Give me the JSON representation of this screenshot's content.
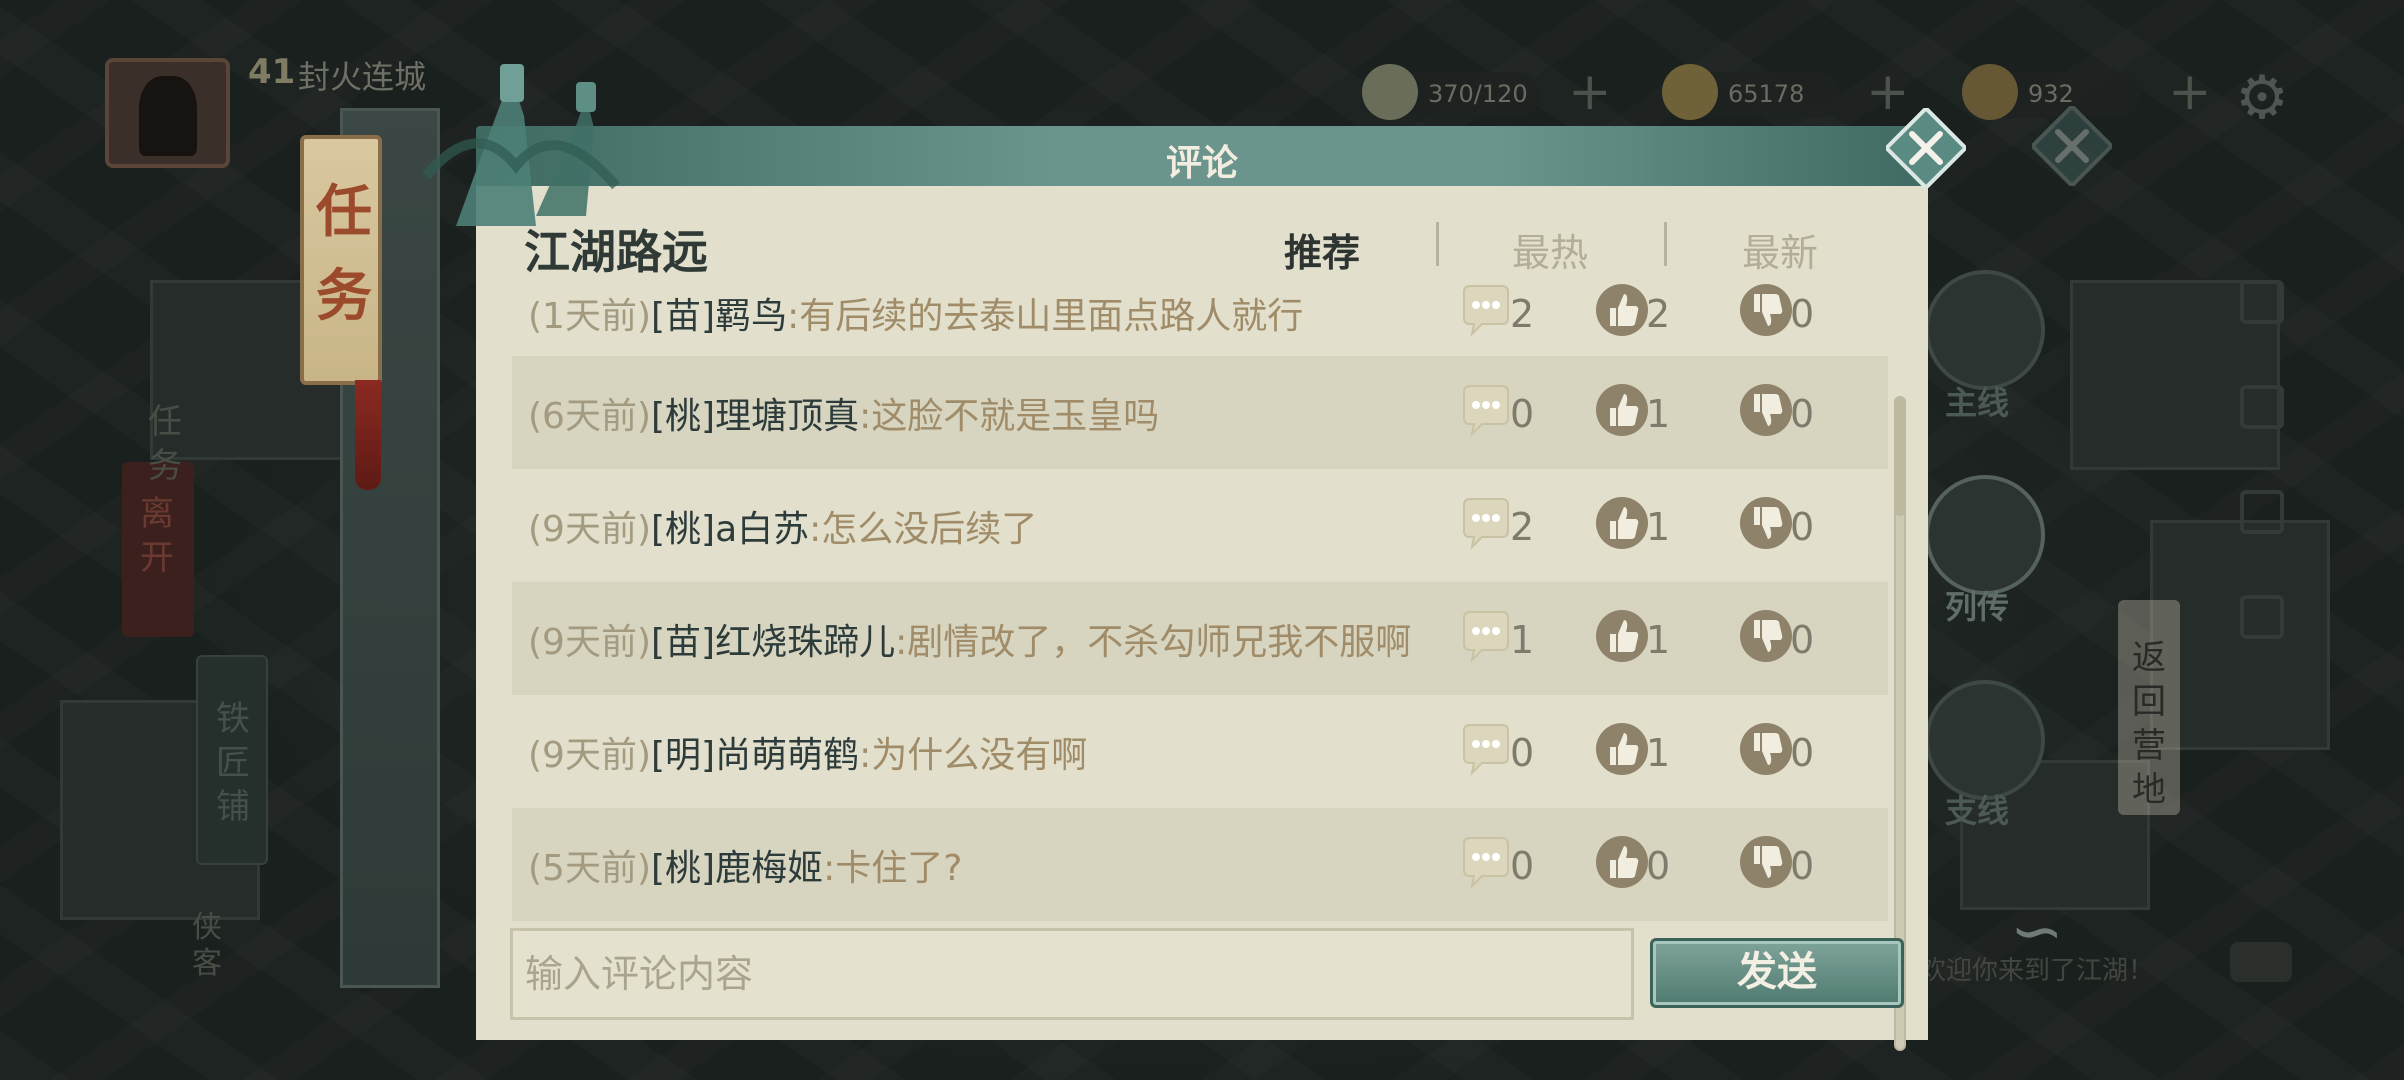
{
  "hud": {
    "player_level": "41",
    "player_name": "封火连城",
    "resources": [
      {
        "icon": "stamina-icon",
        "value": "370/120",
        "color": "#8a8f73"
      },
      {
        "icon": "coin-icon",
        "value": "65178",
        "color": "#8f7a3e"
      },
      {
        "icon": "ingot-icon",
        "value": "932",
        "color": "#7d6a3a"
      }
    ],
    "plus_symbol": "+",
    "gear_symbol": "⚙"
  },
  "left_panel": {
    "task_tag": "任务",
    "task_label": "任务",
    "leave_label": "离开",
    "smith_label": "铁匠铺",
    "hero_label": "侠客"
  },
  "right_nav": {
    "main_label": "主线",
    "biography_label": "列传",
    "side_label": "支线",
    "return_camp": "返回营地",
    "chat_preview": "欢迎你来到了江湖！"
  },
  "dialog": {
    "title": "评论",
    "story_title": "江湖路远",
    "tabs": [
      "推荐",
      "最热",
      "最新"
    ],
    "active_tab": "推荐",
    "comments": [
      {
        "time": "(1天前)",
        "user": "[苗]羁鸟",
        "message": ":有后续的去泰山里面点路人就行",
        "replies": "2",
        "likes": "2",
        "dislikes": "0"
      },
      {
        "time": "(6天前)",
        "user": "[桃]理塘顶真",
        "message": ":这脸不就是玉皇吗",
        "replies": "0",
        "likes": "1",
        "dislikes": "0"
      },
      {
        "time": "(9天前)",
        "user": "[桃]a白苏",
        "message": ":怎么没后续了",
        "replies": "2",
        "likes": "1",
        "dislikes": "0"
      },
      {
        "time": "(9天前)",
        "user": "[苗]红烧珠蹄儿",
        "message": ":剧情改了，不杀勾师兄我不服啊",
        "replies": "1",
        "likes": "1",
        "dislikes": "0"
      },
      {
        "time": "(9天前)",
        "user": "[明]尚萌萌鹤",
        "message": ":为什么没有啊",
        "replies": "0",
        "likes": "1",
        "dislikes": "0"
      },
      {
        "time": "(5天前)",
        "user": "[桃]鹿梅姬",
        "message": ":卡住了?",
        "replies": "0",
        "likes": "0",
        "dislikes": "0"
      }
    ],
    "input_placeholder": "输入评论内容",
    "send_label": "发送",
    "colors": {
      "header": "#6b958c",
      "body": "#e2e0cc",
      "row_alt": "#d7d5c0",
      "icon": "#8e826b"
    }
  }
}
